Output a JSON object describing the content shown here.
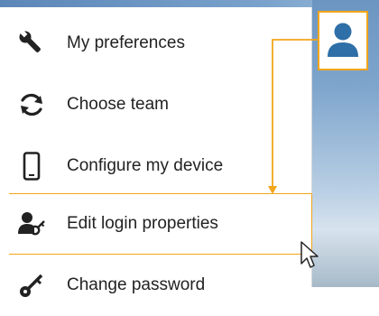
{
  "menu": {
    "items": [
      {
        "label": "My preferences",
        "icon": "wrench-icon"
      },
      {
        "label": "Choose team",
        "icon": "refresh-icon"
      },
      {
        "label": "Configure my device",
        "icon": "mobile-device-icon"
      },
      {
        "label": "Edit login properties",
        "icon": "user-key-icon"
      },
      {
        "label": "Change password",
        "icon": "key-icon"
      }
    ]
  },
  "user_button": {
    "icon": "user-avatar-icon"
  },
  "colors": {
    "accent": "#f2a51a",
    "avatar": "#2e6fa7",
    "icon": "#222222"
  }
}
